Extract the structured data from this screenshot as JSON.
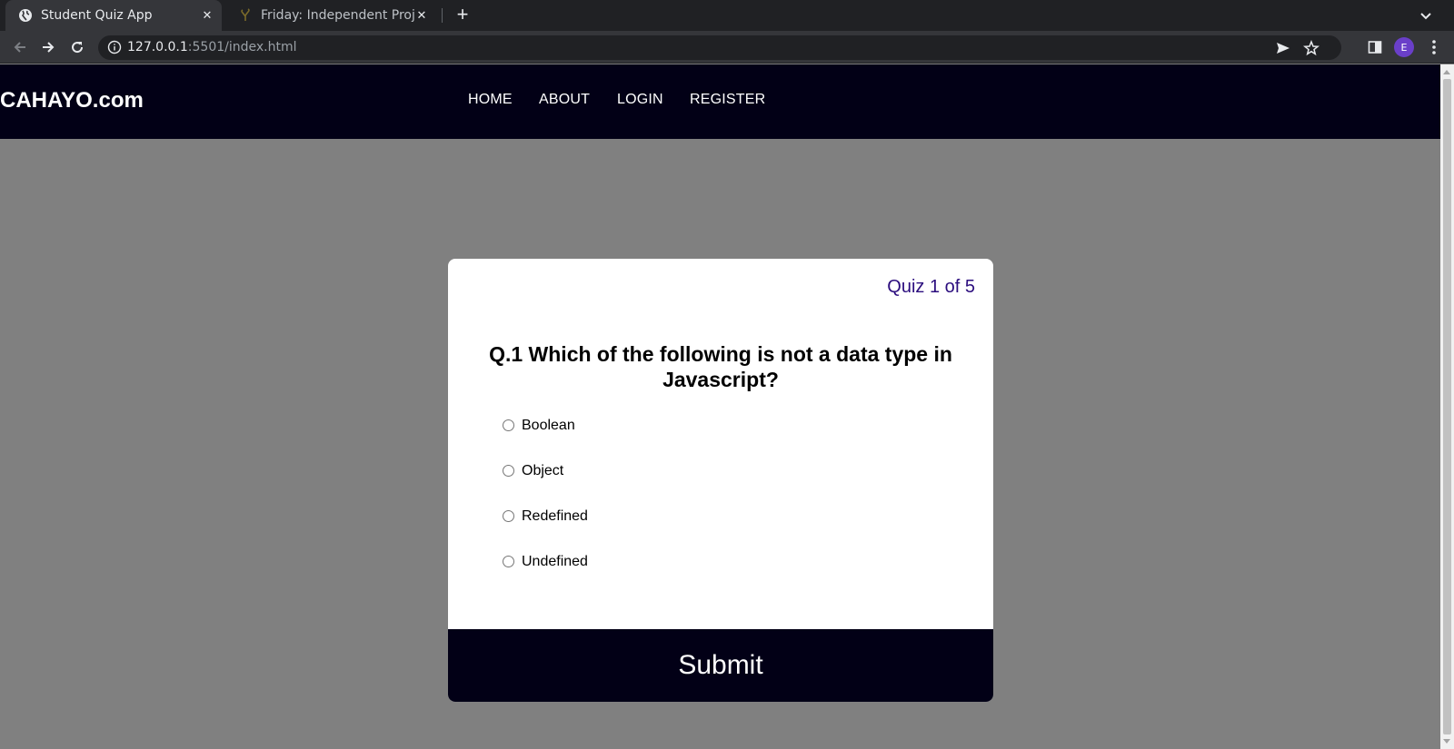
{
  "browser": {
    "tabs": [
      {
        "title": "Student Quiz App",
        "favicon": "globe-icon",
        "active": true
      },
      {
        "title": "Friday: Independent Proje",
        "favicon": "tree-icon",
        "active": false
      }
    ],
    "url_host": "127.0.0.1",
    "url_rest": ":5501/index.html",
    "profile_initial": "E"
  },
  "site": {
    "logo": "CAHAYO.com",
    "nav": [
      "HOME",
      "ABOUT",
      "LOGIN",
      "REGISTER"
    ]
  },
  "quiz": {
    "counter": "Quiz 1 of 5",
    "question": "Q.1 Which of the following is not a data type in Javascript?",
    "options": [
      "Boolean",
      "Object",
      "Redefined",
      "Undefined"
    ],
    "submit_label": "Submit"
  },
  "colors": {
    "nav_bg": "#020016",
    "page_bg": "#808080",
    "counter_text": "#2b0d7e",
    "card_bg": "#ffffff"
  }
}
